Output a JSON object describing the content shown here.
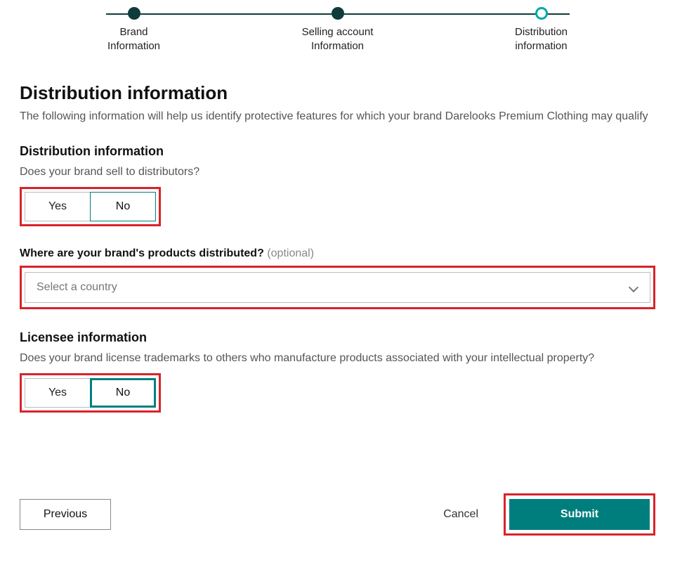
{
  "stepper": {
    "steps": [
      {
        "label": "Brand\nInformation",
        "state": "done"
      },
      {
        "label": "Selling account\nInformation",
        "state": "done"
      },
      {
        "label": "Distribution\ninformation",
        "state": "current"
      }
    ]
  },
  "header": {
    "title": "Distribution information",
    "subtitle": "The following information will help us identify protective features for which your brand Darelooks Premium Clothing may qualify"
  },
  "distribution": {
    "section_title": "Distribution information",
    "q1": "Does your brand sell to distributors?",
    "yes": "Yes",
    "no": "No",
    "selected": "No",
    "countries_label": "Where are your brand's products distributed?",
    "optional_text": "(optional)",
    "countries_placeholder": "Select a country"
  },
  "licensee": {
    "section_title": "Licensee information",
    "q1": "Does your brand license trademarks to others who manufacture products associated with your intellectual property?",
    "yes": "Yes",
    "no": "No",
    "selected": "No"
  },
  "footer": {
    "previous": "Previous",
    "cancel": "Cancel",
    "submit": "Submit"
  }
}
